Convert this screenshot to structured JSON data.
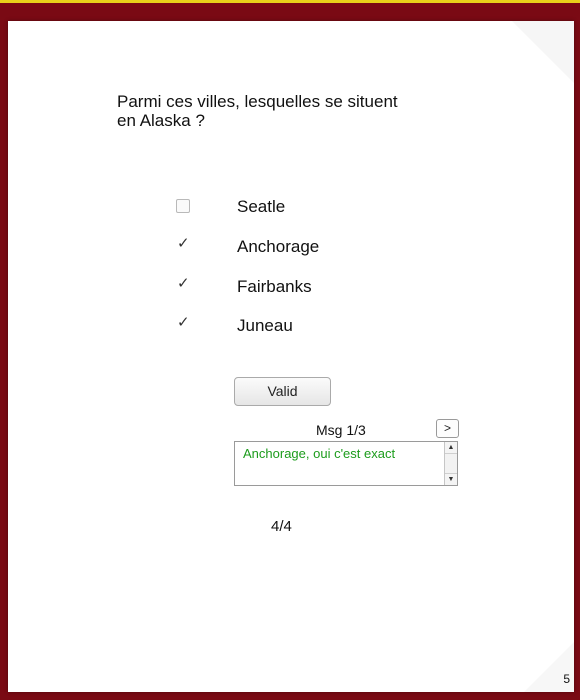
{
  "question": "Parmi ces villes, lesquelles se situent en Alaska ?",
  "options": [
    {
      "label": "Seatle",
      "checked": false
    },
    {
      "label": "Anchorage",
      "checked": true
    },
    {
      "label": "Fairbanks",
      "checked": true
    },
    {
      "label": "Juneau",
      "checked": true
    }
  ],
  "checkmark_glyph": "✓",
  "validate_label": "Valid",
  "messages": {
    "counter": "Msg 1/3",
    "next_label": ">",
    "current_text": "Anchorage, oui c'est exact"
  },
  "score": "4/4",
  "page_number": "5",
  "colors": {
    "frame": "#7a0a14",
    "top_strip": "#e8d21a",
    "feedback_text": "#1c9c1c"
  }
}
